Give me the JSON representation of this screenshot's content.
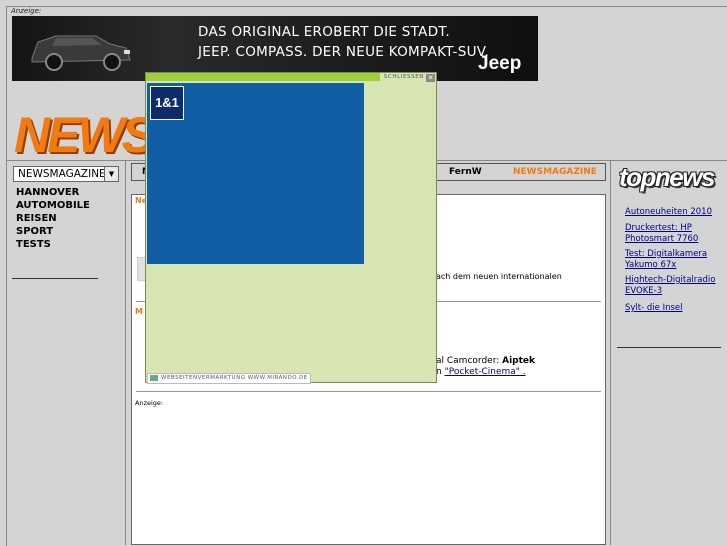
{
  "top_ad": {
    "label": "Anzeige:",
    "line1": "DAS ORIGINAL EROBERT DIE STADT.",
    "line2": "JEEP. COMPASS. DER NEUE KOMPAKT-SUV.",
    "brand": "Jeep"
  },
  "logo_text": "NEWSMA",
  "left": {
    "select_value": "NEWSMAGAZINE",
    "select_arrow": "▼",
    "nav": [
      "HANNOVER",
      "AUTOMOBILE",
      "REISEN",
      "SPORT",
      "TESTS"
    ]
  },
  "tabs": {
    "first": "M",
    "fernw": "FernW",
    "active": "NEWSMAGAZINE"
  },
  "content": {
    "peek1": "Ne",
    "snippet1": "ach dem neuen internationalen",
    "peek2": "M",
    "snippet2_prefix": "al Camcorder: ",
    "snippet2_bold": "Aiptek",
    "snippet3_prefix": "n ",
    "snippet3_link": "\"Pocket-Cinema\" .",
    "ad_label": "Anzeige:"
  },
  "right": {
    "title": "topnews",
    "links": [
      "Autoneuheiten 2010",
      "Druckertest: HP Photosmart 7760",
      "Test: Digitalkamera Yakumo 67x",
      "Hightech-Digitalradio EVOKE-3",
      "Sylt- die Insel"
    ]
  },
  "popup": {
    "close_label": "SCHLIESSEN",
    "close_x": "✕",
    "brand": "1&1",
    "footer": "WEBSEITENVERMARKTUNG WWW.MIRANDO.DE"
  },
  "colors": {
    "accent": "#f07b10",
    "link": "#00008b",
    "popup_bg": "#d6e5b1",
    "ad_blue": "#125ea5"
  }
}
